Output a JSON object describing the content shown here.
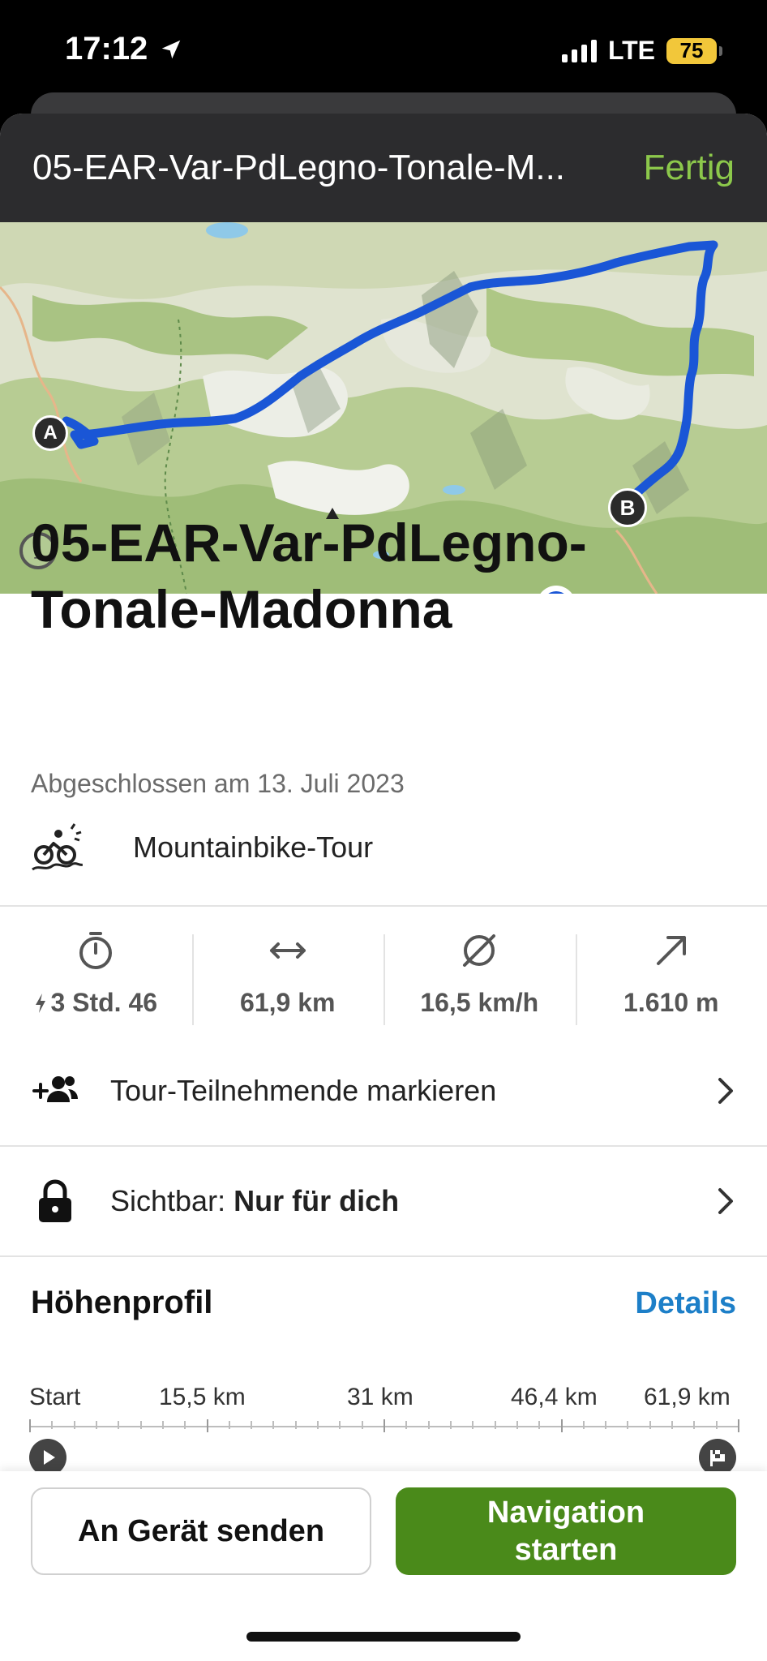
{
  "status_bar": {
    "time": "17:12",
    "network": "LTE",
    "battery": "75",
    "icons": [
      "location-arrow-icon",
      "signal-icon",
      "battery-icon"
    ]
  },
  "header": {
    "title": "05-EAR-Var-PdLegno-Tonale-M...",
    "done_label": "Fertig"
  },
  "map": {
    "start_marker": "A",
    "end_marker": "B",
    "route_color": "#1a56d6",
    "info_label": "i"
  },
  "tour": {
    "title": "05-EAR-Var-PdLegno-Tonale-Madonna",
    "completed": "Abgeschlossen am 13. Juli 2023",
    "type": "Mountainbike-Tour"
  },
  "stats": [
    {
      "icon": "stopwatch-icon",
      "value": "3 Std. 46",
      "prefix_icon": "lightning-icon"
    },
    {
      "icon": "distance-arrows-icon",
      "value": "61,9 km"
    },
    {
      "icon": "average-speed-icon",
      "value": "16,5 km/h"
    },
    {
      "icon": "ascent-arrow-icon",
      "value": "1.610 m"
    }
  ],
  "rows": {
    "participants": {
      "label": "Tour-Teilnehmende markieren",
      "icon": "add-people-icon"
    },
    "visibility": {
      "label": "Sichtbar:",
      "value": "Nur für dich",
      "icon": "lock-icon"
    }
  },
  "elevation": {
    "title": "Höhenprofil",
    "details_label": "Details",
    "axis_labels": [
      "Start",
      "15,5 km",
      "31 km",
      "46,4 km",
      "61,9 km"
    ]
  },
  "actions": {
    "send_label": "An Gerät senden",
    "navigate_label": "Navigation starten"
  },
  "colors": {
    "accent_green": "#4a8a1a",
    "done_green": "#8cc84b",
    "link_blue": "#1d7fc8",
    "header_bg": "#2c2c2e"
  }
}
